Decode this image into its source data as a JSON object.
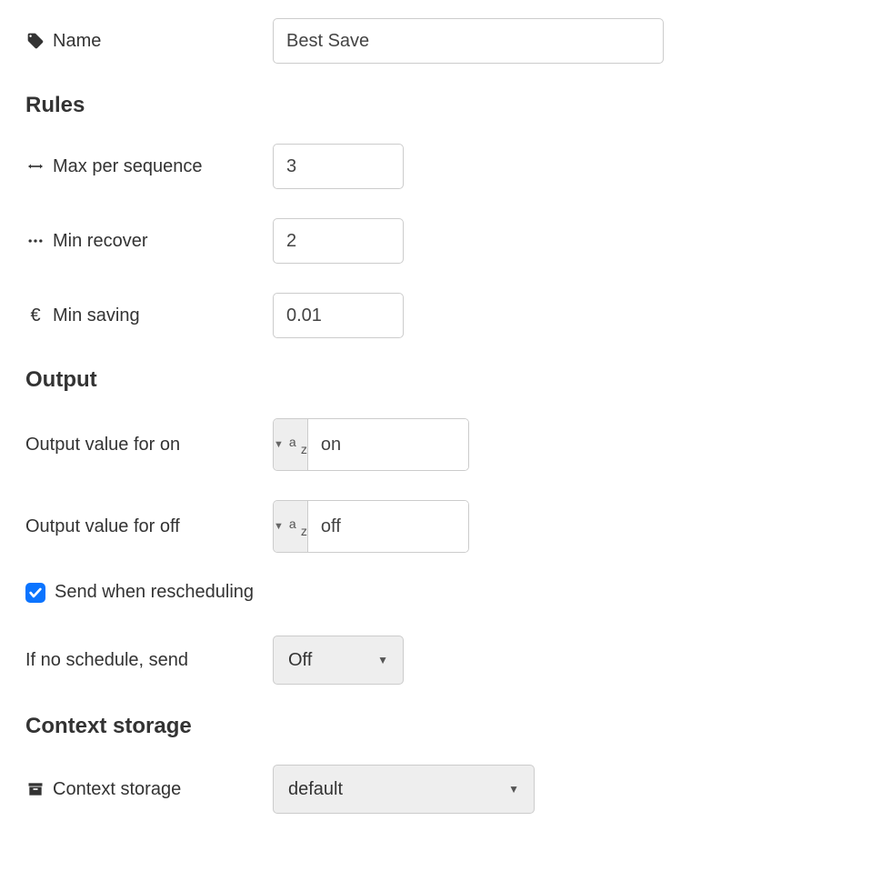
{
  "name": {
    "label": "Name",
    "value": "Best Save"
  },
  "sections": {
    "rules": "Rules",
    "output": "Output",
    "context": "Context storage"
  },
  "rules": {
    "maxPerSequence": {
      "label": "Max per sequence",
      "value": "3"
    },
    "minRecover": {
      "label": "Min recover",
      "value": "2"
    },
    "minSaving": {
      "label": "Min saving",
      "value": "0.01",
      "currency": "€"
    }
  },
  "output": {
    "onLabel": "Output value for on",
    "onValue": "on",
    "offLabel": "Output value for off",
    "offValue": "off",
    "sendWhenReschedulingLabel": "Send when rescheduling",
    "sendWhenReschedulingChecked": true,
    "ifNoScheduleLabel": "If no schedule, send",
    "ifNoScheduleValue": "Off"
  },
  "context": {
    "label": "Context storage",
    "value": "default"
  }
}
